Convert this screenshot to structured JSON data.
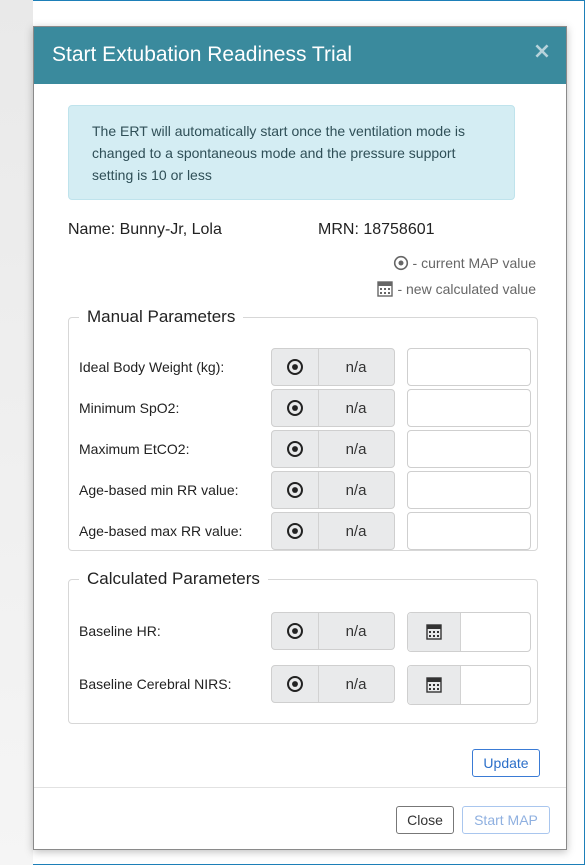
{
  "modal": {
    "title": "Start Extubation Readiness Trial",
    "close_symbol": "×",
    "info_message": "The ERT will automatically start once the ventilation mode is changed to a spontaneous mode and the pressure support setting is 10 or less",
    "patient": {
      "name_label": "Name: Bunny-Jr, Lola",
      "mrn_label": "MRN: 18758601"
    },
    "legend": {
      "current": {
        "icon": "dot-circle-icon",
        "text": "- current MAP value"
      },
      "new": {
        "icon": "calculator-icon",
        "text": "- new calculated value"
      }
    },
    "manual": {
      "title": "Manual Parameters",
      "rows": [
        {
          "label": "Ideal Body Weight (kg):",
          "current": "n/a",
          "new_value": ""
        },
        {
          "label": "Minimum SpO2:",
          "current": "n/a",
          "new_value": ""
        },
        {
          "label": "Maximum EtCO2:",
          "current": "n/a",
          "new_value": ""
        },
        {
          "label": "Age-based min RR value:",
          "current": "n/a",
          "new_value": ""
        },
        {
          "label": "Age-based max RR value:",
          "current": "n/a",
          "new_value": ""
        }
      ]
    },
    "calculated": {
      "title": "Calculated Parameters",
      "rows": [
        {
          "label": "Baseline HR:",
          "current": "n/a",
          "new_value": ""
        },
        {
          "label": "Baseline Cerebral NIRS:",
          "current": "n/a",
          "new_value": ""
        }
      ]
    },
    "buttons": {
      "update": "Update",
      "close": "Close",
      "start_map": "Start MAP"
    }
  },
  "colors": {
    "header": "#3a8a9d",
    "alert_bg": "#d4edf3",
    "primary": "#2c6fc9"
  }
}
